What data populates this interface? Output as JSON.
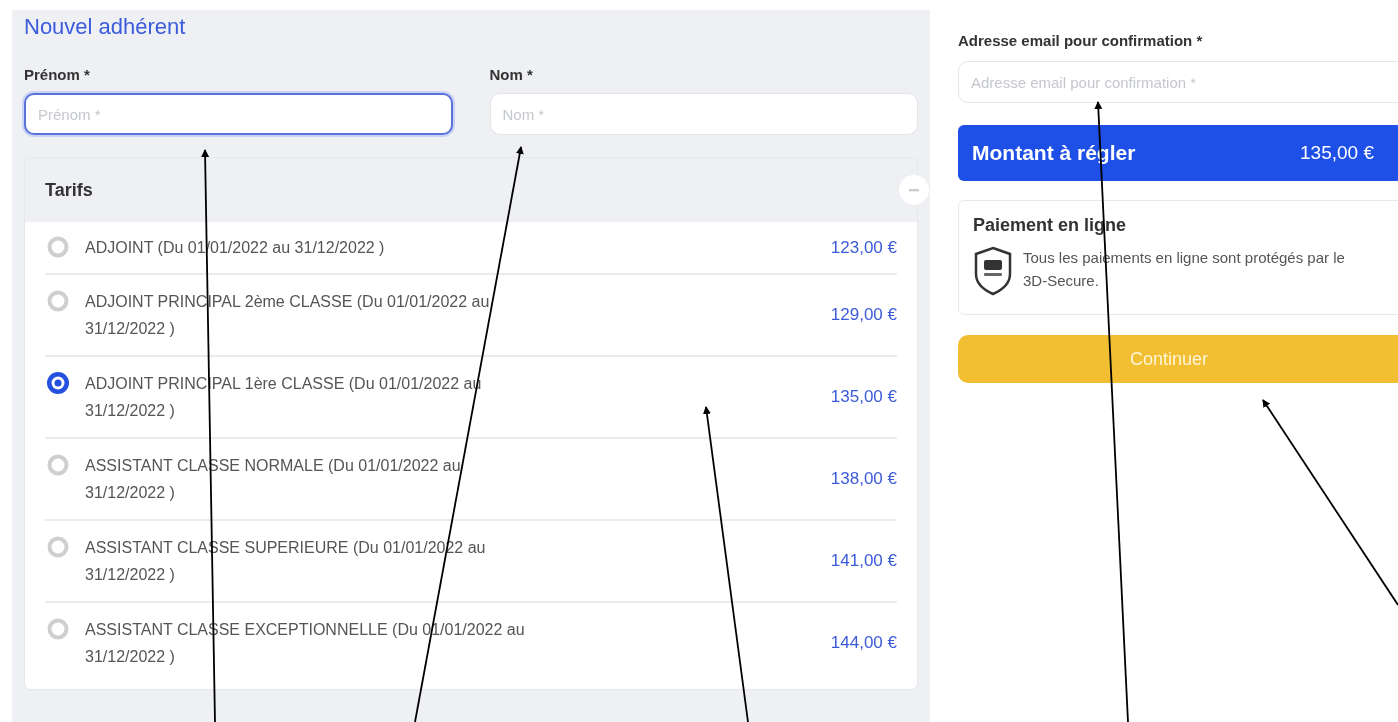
{
  "form": {
    "title": "Nouvel adhérent",
    "fields": [
      {
        "label": "Prénom *",
        "placeholder": "Prénom *",
        "focused": true
      },
      {
        "label": "Nom *",
        "placeholder": "Nom *",
        "focused": false
      }
    ]
  },
  "tarifs": {
    "title": "Tarifs",
    "expanded": true,
    "options": [
      {
        "label": "ADJOINT (Du 01/01/2022 au 31/12/2022 )",
        "price": "123,00 €",
        "selected": false
      },
      {
        "label": "ADJOINT PRINCIPAL 2ème CLASSE (Du 01/01/2022 au 31/12/2022 )",
        "price": "129,00 €",
        "selected": false
      },
      {
        "label": "ADJOINT PRINCIPAL 1ère CLASSE (Du 01/01/2022 au 31/12/2022 )",
        "price": "135,00 €",
        "selected": true
      },
      {
        "label": "ASSISTANT CLASSE NORMALE (Du 01/01/2022 au 31/12/2022 )",
        "price": "138,00 €",
        "selected": false
      },
      {
        "label": "ASSISTANT CLASSE SUPERIEURE (Du 01/01/2022 au 31/12/2022 )",
        "price": "141,00 €",
        "selected": false
      },
      {
        "label": "ASSISTANT CLASSE EXCEPTIONNELLE (Du 01/01/2022 au 31/12/2022 )",
        "price": "144,00 €",
        "selected": false
      }
    ]
  },
  "confirmation": {
    "email_label": "Adresse email pour confirmation *",
    "email_placeholder": "Adresse email pour confirmation *",
    "amount_label": "Montant à régler",
    "amount": "135,00 €",
    "payment_title": "Paiement en ligne",
    "payment_text": "Tous les paiements en ligne sont protégés par le 3D-Secure.",
    "continue_button": "Continuer"
  }
}
